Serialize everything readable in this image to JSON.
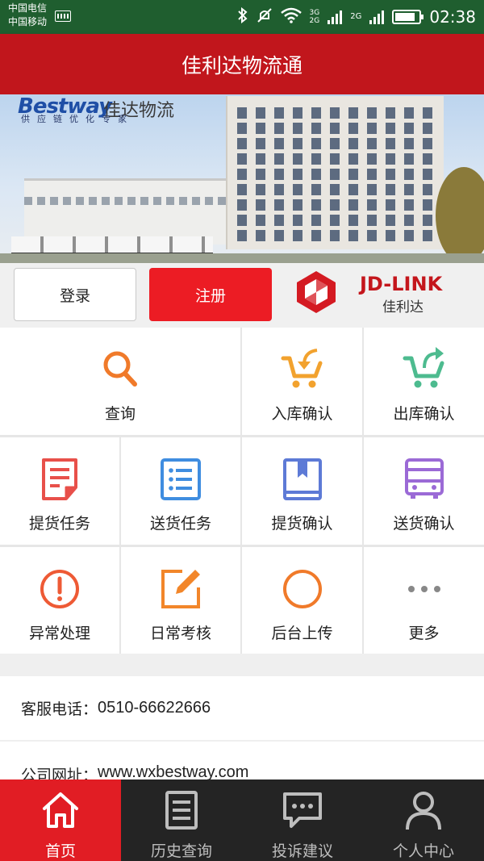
{
  "status_bar": {
    "carrier_1": "中国电信",
    "carrier_2": "中国移动",
    "net_a_top": "3G",
    "net_a_bottom": "2G",
    "net_b": "2G",
    "time": "02:38"
  },
  "header": {
    "title": "佳利达物流通"
  },
  "banner": {
    "logo_text": "Bestway",
    "logo_cn": "佳达物流",
    "slogan": "供应链优化专家"
  },
  "auth": {
    "login_label": "登录",
    "register_label": "注册",
    "brand_name": "JD-LINK",
    "brand_cn": "佳利达"
  },
  "menu": [
    {
      "label": "查询",
      "icon": "search-icon",
      "color": "#f07a2a"
    },
    {
      "label": "入库确认",
      "icon": "cart-in-icon",
      "color": "#f2a22e"
    },
    {
      "label": "出库确认",
      "icon": "cart-out-icon",
      "color": "#4dbb8f"
    },
    {
      "label": "提货任务",
      "icon": "document-icon",
      "color": "#e8504a"
    },
    {
      "label": "送货任务",
      "icon": "list-icon",
      "color": "#3f8de0"
    },
    {
      "label": "提货确认",
      "icon": "book-icon",
      "color": "#5d7ad6"
    },
    {
      "label": "送货确认",
      "icon": "bus-icon",
      "color": "#9b6ad6"
    },
    {
      "label": "异常处理",
      "icon": "alert-icon",
      "color": "#ee5a35"
    },
    {
      "label": "日常考核",
      "icon": "edit-icon",
      "color": "#f2862a"
    },
    {
      "label": "后台上传",
      "icon": "circle-icon",
      "color": "#f07a2a"
    },
    {
      "label": "更多",
      "icon": "more-icon",
      "color": "#888888"
    }
  ],
  "info": {
    "phone_label": "客服电话：",
    "phone_value": "0510-66622666",
    "site_label": "公司网址：",
    "site_value": "www.wxbestway.com"
  },
  "tabs": [
    {
      "label": "首页",
      "icon": "home-icon",
      "active": true
    },
    {
      "label": "历史查询",
      "icon": "history-icon",
      "active": false
    },
    {
      "label": "投诉建议",
      "icon": "chat-icon",
      "active": false
    },
    {
      "label": "个人中心",
      "icon": "user-icon",
      "active": false
    }
  ],
  "colors": {
    "status_bar": "#1f5e2f",
    "title_bar": "#c1161c",
    "register_button": "#ec1c24",
    "active_tab": "#e11d24",
    "tab_bar": "#242424"
  }
}
